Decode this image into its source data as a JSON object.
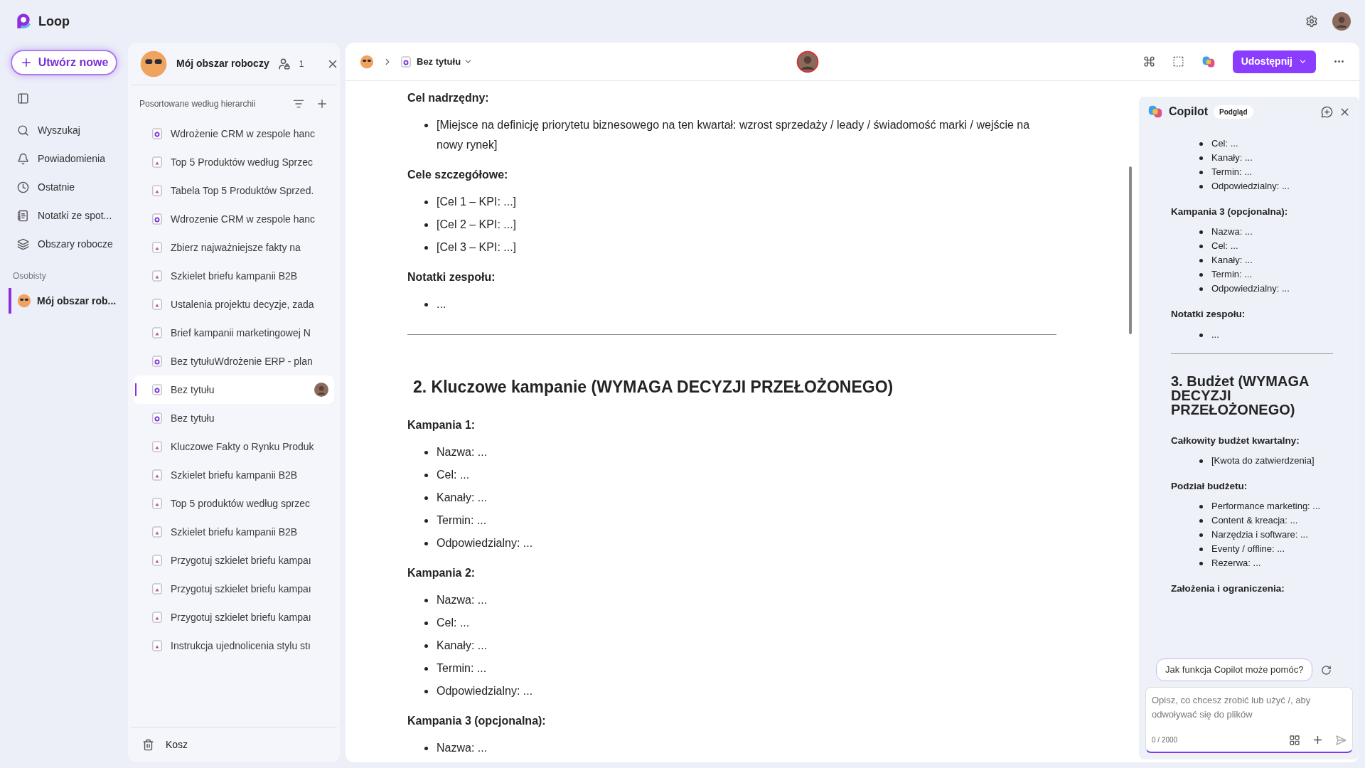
{
  "app": {
    "name": "Loop"
  },
  "nav": {
    "create_button": "Utwórz nowe",
    "items": [
      {
        "label": "Wyszukaj"
      },
      {
        "label": "Powiadomienia"
      },
      {
        "label": "Ostatnie"
      },
      {
        "label": "Notatki ze spot..."
      },
      {
        "label": "Obszary robocze"
      }
    ],
    "section": "Osobisty",
    "workspaces": [
      {
        "label": "Mój obszar rob...",
        "selected": true
      }
    ]
  },
  "workspace": {
    "title": "Mój obszar roboczy",
    "members": "1",
    "sort_label": "Posortowane według hierarchii",
    "pages": [
      {
        "title": "Wdrożenie CRM w zespole hanc",
        "kind": "loop",
        "selected": false,
        "collaborator": false
      },
      {
        "title": "Top 5 Produktów według Sprzec",
        "kind": "page",
        "selected": false,
        "collaborator": false
      },
      {
        "title": "Tabela Top 5 Produktów Sprzed.",
        "kind": "page",
        "selected": false,
        "collaborator": false
      },
      {
        "title": "Wdrozenie CRM w zespole hanc",
        "kind": "loop",
        "selected": false,
        "collaborator": false
      },
      {
        "title": "Zbierz najważniejsze fakty na",
        "kind": "page",
        "selected": false,
        "collaborator": false
      },
      {
        "title": "Szkielet briefu kampanii B2B",
        "kind": "page",
        "selected": false,
        "collaborator": false
      },
      {
        "title": "Ustalenia projektu decyzje, zada",
        "kind": "page",
        "selected": false,
        "collaborator": false
      },
      {
        "title": "Brief kampanii marketingowej N",
        "kind": "page",
        "selected": false,
        "collaborator": false
      },
      {
        "title": "Bez tytułuWdrożenie ERP - plan",
        "kind": "loop",
        "selected": false,
        "collaborator": false
      },
      {
        "title": "Bez tytułu",
        "kind": "loop",
        "selected": true,
        "collaborator": true
      },
      {
        "title": "Bez tytułu",
        "kind": "loop",
        "selected": false,
        "collaborator": false
      },
      {
        "title": "Kluczowe Fakty o Rynku Produk",
        "kind": "page",
        "selected": false,
        "collaborator": false
      },
      {
        "title": "Szkielet briefu kampanii B2B",
        "kind": "page",
        "selected": false,
        "collaborator": false
      },
      {
        "title": "Top 5 produktów według sprzec",
        "kind": "page",
        "selected": false,
        "collaborator": false
      },
      {
        "title": "Szkielet briefu kampanii B2B",
        "kind": "page",
        "selected": false,
        "collaborator": false
      },
      {
        "title": "Przygotuj szkielet briefu kampaı",
        "kind": "page",
        "selected": false,
        "collaborator": false
      },
      {
        "title": "Przygotuj szkielet briefu kampaı",
        "kind": "page",
        "selected": false,
        "collaborator": false
      },
      {
        "title": "Przygotuj szkielet briefu kampaı",
        "kind": "page",
        "selected": false,
        "collaborator": false
      },
      {
        "title": "Instrukcja ujednolicenia stylu stı",
        "kind": "page",
        "selected": false,
        "collaborator": false
      }
    ],
    "trash": "Kosz"
  },
  "document": {
    "breadcrumb": "Bez tytułu",
    "share_button": "Udostępnij",
    "blocks": [
      {
        "kind": "label",
        "text": "Cel nadrzędny:"
      },
      {
        "kind": "bullets",
        "items": [
          "[Miejsce na definicję priorytetu biznesowego na ten kwartał: wzrost sprzedaży / leady / świadomość marki / wejście na nowy rynek]"
        ]
      },
      {
        "kind": "label",
        "text": "Cele szczegółowe:"
      },
      {
        "kind": "bullets",
        "items": [
          "[Cel 1 – KPI: ...]",
          "[Cel 2 – KPI: ...]",
          "[Cel 3 – KPI: ...]"
        ]
      },
      {
        "kind": "label",
        "text": "Notatki zespołu:"
      },
      {
        "kind": "bullets",
        "items": [
          "..."
        ]
      },
      {
        "kind": "divider"
      },
      {
        "kind": "heading",
        "text": "2. Kluczowe kampanie (WYMAGA DECYZJI PRZEŁOŻONEGO)"
      },
      {
        "kind": "label",
        "text": "Kampania 1:"
      },
      {
        "kind": "bullets",
        "items": [
          "Nazwa: ...",
          "Cel: ...",
          "Kanały: ...",
          "Termin: ...",
          "Odpowiedzialny: ..."
        ]
      },
      {
        "kind": "label",
        "text": "Kampania 2:"
      },
      {
        "kind": "bullets",
        "items": [
          "Nazwa: ...",
          "Cel: ...",
          "Kanały: ...",
          "Termin: ...",
          "Odpowiedzialny: ..."
        ]
      },
      {
        "kind": "label",
        "text": "Kampania 3 (opcjonalna):"
      },
      {
        "kind": "bullets",
        "items": [
          "Nazwa: ..."
        ]
      }
    ]
  },
  "copilot": {
    "title": "Copilot",
    "badge": "Podgląd",
    "blocks": [
      {
        "kind": "bullets",
        "items": [
          "Cel: ...",
          "Kanały: ...",
          "Termin: ...",
          "Odpowiedzialny: ..."
        ]
      },
      {
        "kind": "label",
        "text": "Kampania 3 (opcjonalna):"
      },
      {
        "kind": "bullets",
        "items": [
          "Nazwa: ...",
          "Cel: ...",
          "Kanały: ...",
          "Termin: ...",
          "Odpowiedzialny: ..."
        ]
      },
      {
        "kind": "label",
        "text": "Notatki zespołu:"
      },
      {
        "kind": "bullets",
        "items": [
          "..."
        ]
      },
      {
        "kind": "divider"
      },
      {
        "kind": "heading",
        "text": "3. Budżet (WYMAGA DECYZJI PRZEŁOŻONEGO)"
      },
      {
        "kind": "label",
        "text": "Całkowity budżet kwartalny:"
      },
      {
        "kind": "bullets",
        "items": [
          "[Kwota do zatwierdzenia]"
        ]
      },
      {
        "kind": "label",
        "text": "Podział budżetu:"
      },
      {
        "kind": "bullets",
        "items": [
          "Performance marketing: ...",
          "Content & kreacja: ...",
          "Narzędzia i software: ...",
          "Eventy / offline: ...",
          "Rezerwa: ..."
        ]
      },
      {
        "kind": "label",
        "text": "Założenia i ograniczenia:"
      }
    ],
    "suggestion": "Jak funkcja Copilot może pomóc?",
    "placeholder": "Opisz, co chcesz zrobić lub użyć /, aby odwoływać się do plików",
    "counter": "0 / 2000"
  }
}
